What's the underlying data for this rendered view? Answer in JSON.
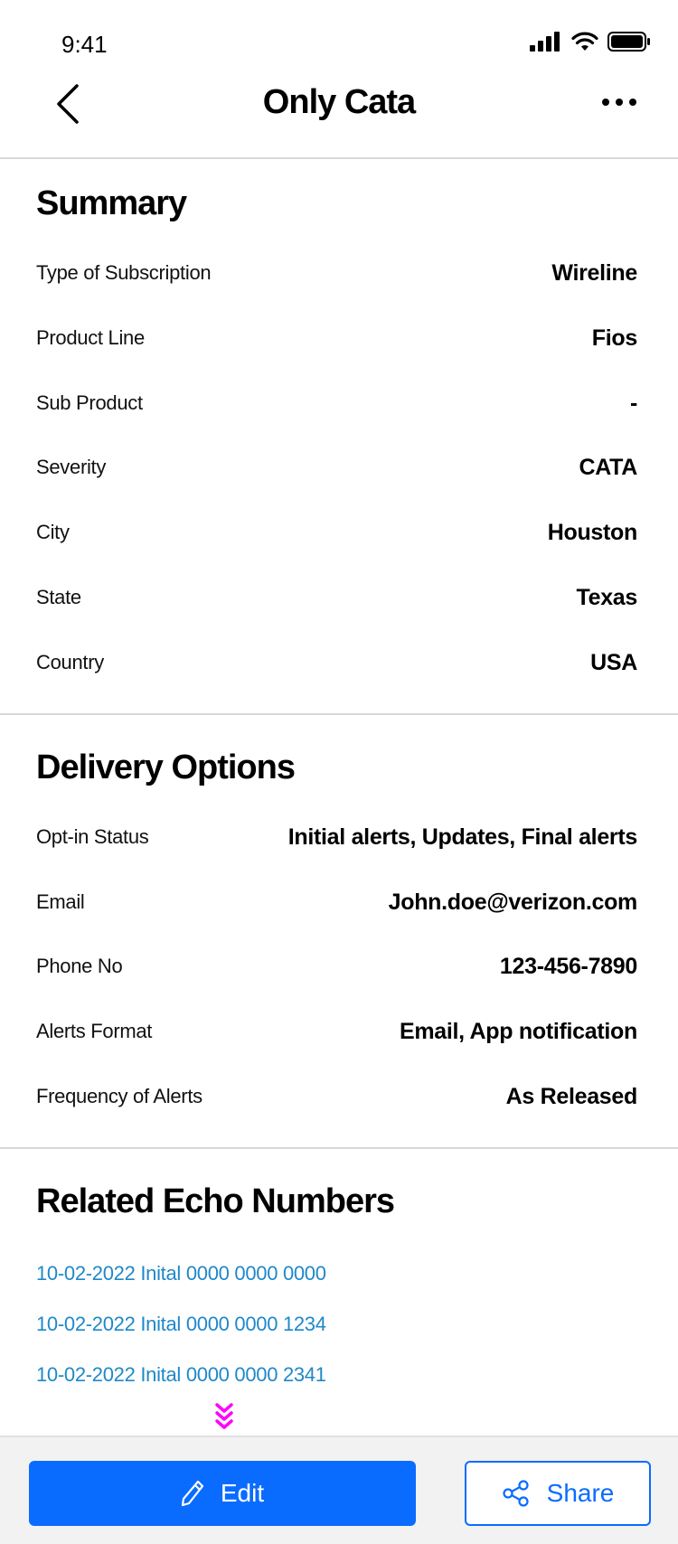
{
  "status_bar": {
    "time": "9:41"
  },
  "nav": {
    "title": "Only Cata"
  },
  "summary": {
    "title": "Summary",
    "rows": [
      {
        "label": "Type of Subscription",
        "value": "Wireline"
      },
      {
        "label": "Product Line",
        "value": "Fios"
      },
      {
        "label": "Sub Product",
        "value": "-"
      },
      {
        "label": "Severity",
        "value": "CATA"
      },
      {
        "label": "City",
        "value": "Houston"
      },
      {
        "label": "State",
        "value": "Texas"
      },
      {
        "label": "Country",
        "value": "USA"
      }
    ]
  },
  "delivery": {
    "title": "Delivery Options",
    "rows": [
      {
        "label": "Opt-in Status",
        "value": "Initial alerts, Updates, Final alerts"
      },
      {
        "label": "Email",
        "value": "John.doe@verizon.com"
      },
      {
        "label": "Phone No",
        "value": "123-456-7890"
      },
      {
        "label": "Alerts Format",
        "value": "Email, App notification"
      },
      {
        "label": "Frequency of Alerts",
        "value": "As Released"
      }
    ]
  },
  "echo": {
    "title": "Related Echo Numbers",
    "links": [
      "10-02-2022  Inital 0000 0000 0000",
      "10-02-2022  Inital 0000 0000 1234",
      "10-02-2022  Inital 0000 0000 2341"
    ]
  },
  "actions": {
    "edit_label": "Edit",
    "share_label": "Share"
  },
  "colors": {
    "primary": "#0a6cff",
    "link": "#1f88c8",
    "scroll_hint": "#ff00ff"
  }
}
